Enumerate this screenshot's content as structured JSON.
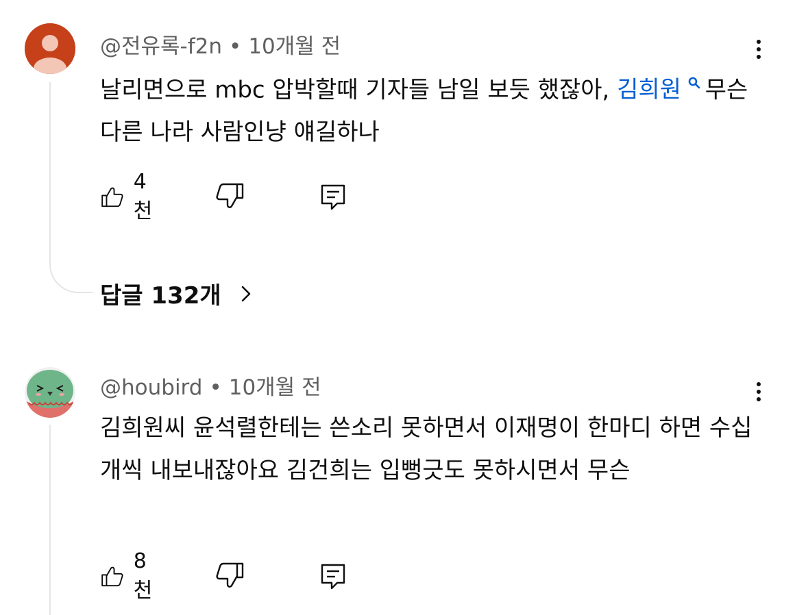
{
  "comments": [
    {
      "author": "@전유록-f2n",
      "separator": "•",
      "time": "10개월 전",
      "text_before": "날리면으로 mbc 압박할때 기자들 남일 보듯 했잖아, ",
      "mention": "김희원",
      "text_after": " 무슨 다른 나라 사람인냥 얘길하나",
      "likes": "4천",
      "replies_label": "답글 132개",
      "avatar_color": "#c6401a",
      "avatar_icon": "default-person-avatar"
    },
    {
      "author": "@houbird",
      "separator": "•",
      "time": "10개월 전",
      "text": "김희원씨 윤석렬한테는 쓴소리 못하면서 이재명이 한마디 하면 수십개씩 내보내잖아요 김건희는 입뻥긋도 못하시면서 무슨",
      "likes": "8천",
      "avatar_icon": "green-bird-avatar"
    }
  ],
  "icons": {
    "like": "thumbs-up-icon",
    "dislike": "thumbs-down-icon",
    "reply": "reply-comment-icon",
    "more": "more-vert-icon",
    "chevron": "chevron-right-icon",
    "mention": "search-icon"
  },
  "colors": {
    "text_primary": "#0f0f0f",
    "text_secondary": "#606060",
    "link": "#065fd4",
    "thread_line": "#e5e5e5"
  }
}
